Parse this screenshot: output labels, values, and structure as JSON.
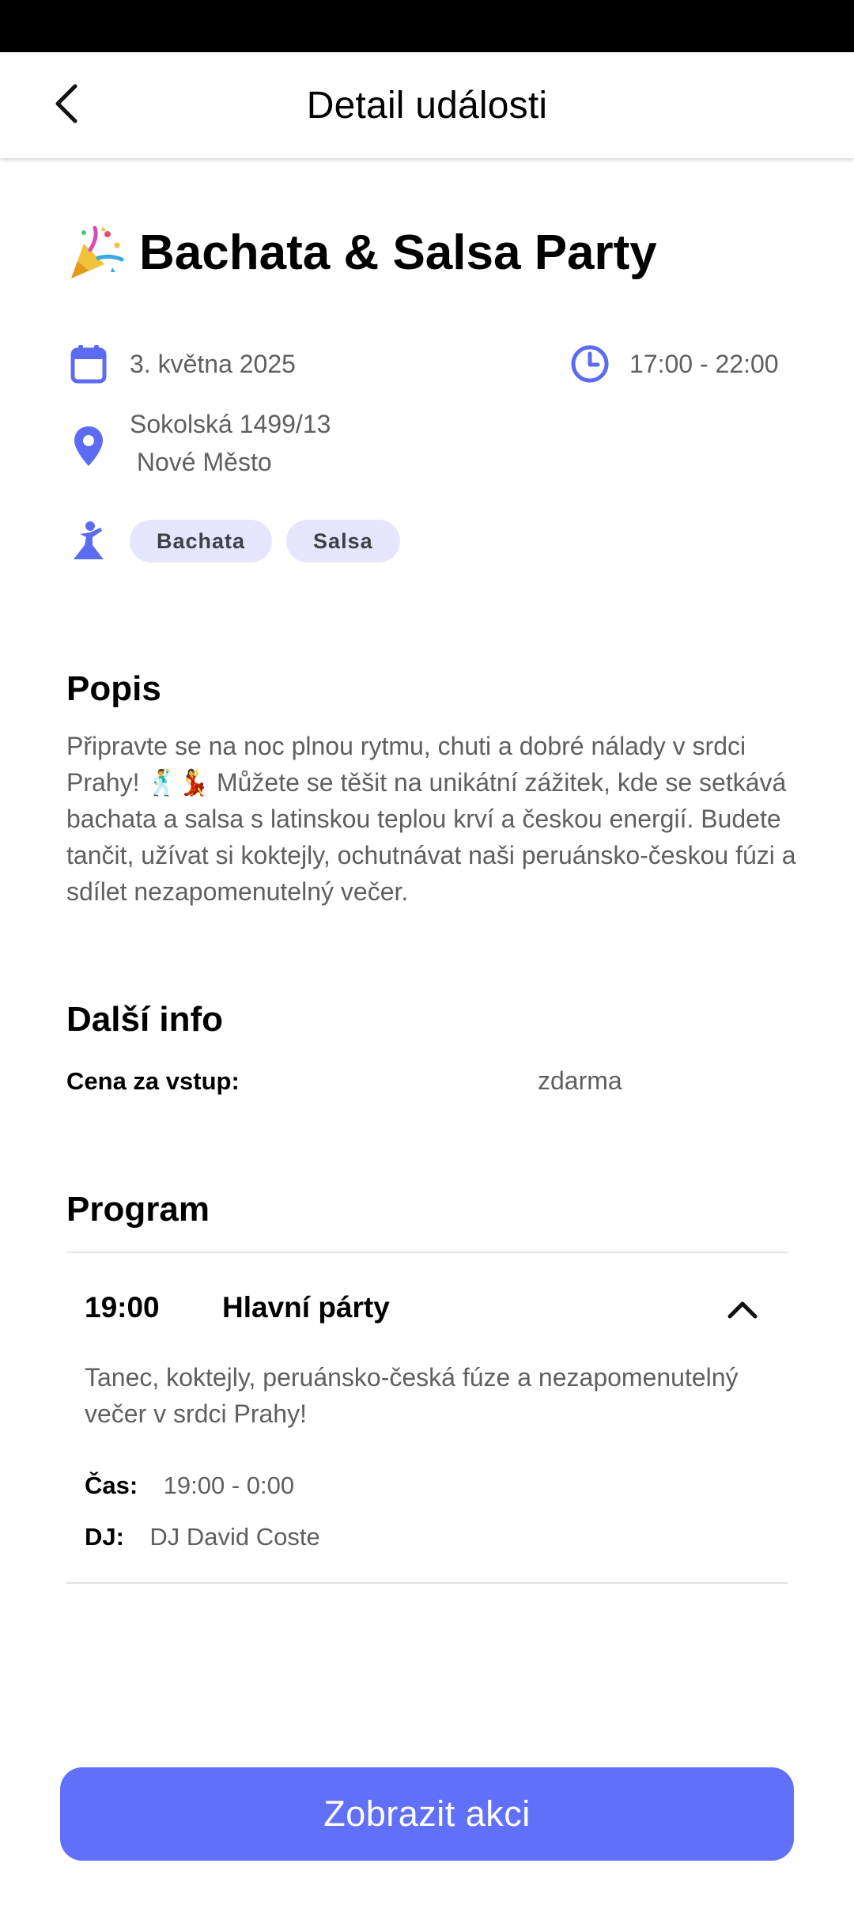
{
  "header": {
    "title": "Detail události",
    "back_icon": "chevron-left-icon"
  },
  "event": {
    "title": "Bachata & Salsa Party",
    "title_icon": "party-popper-icon",
    "date": "3. května 2025",
    "time": "17:00 - 22:00",
    "address_line1": "Sokolská 1499/13",
    "address_line2": " Nové Město",
    "tags": [
      "Bachata",
      "Salsa"
    ]
  },
  "description": {
    "heading": "Popis",
    "text": "Připravte se na noc plnou rytmu, chuti a dobré nálady v srdci Prahy! 🕺💃 Můžete se těšit na unikátní zážitek, kde se setkává bachata a salsa s latinskou teplou krví a českou energií. Budete tančit, užívat si koktejly, ochutnávat naši peruánsko-českou fúzi a sdílet nezapomenutelný večer."
  },
  "more_info": {
    "heading": "Další info",
    "price_label": "Cena za vstup:",
    "price_value": "zdarma"
  },
  "program": {
    "heading": "Program",
    "items": [
      {
        "time": "19:00",
        "name": "Hlavní párty",
        "description": "Tanec, koktejly, peruánsko-česká fúze a nezapomenutelný večer v srdci Prahy!",
        "time_label": "Čas:",
        "time_range": "19:00 - 0:00",
        "dj_label": "DJ:",
        "dj_name": "DJ David Coste",
        "expanded": true
      }
    ]
  },
  "cta": {
    "label": "Zobrazit akci"
  },
  "colors": {
    "accent": "#6170f9",
    "icon": "#5b6cf2",
    "tag_bg": "#e5e6fc",
    "muted_text": "#5f5f5f"
  }
}
